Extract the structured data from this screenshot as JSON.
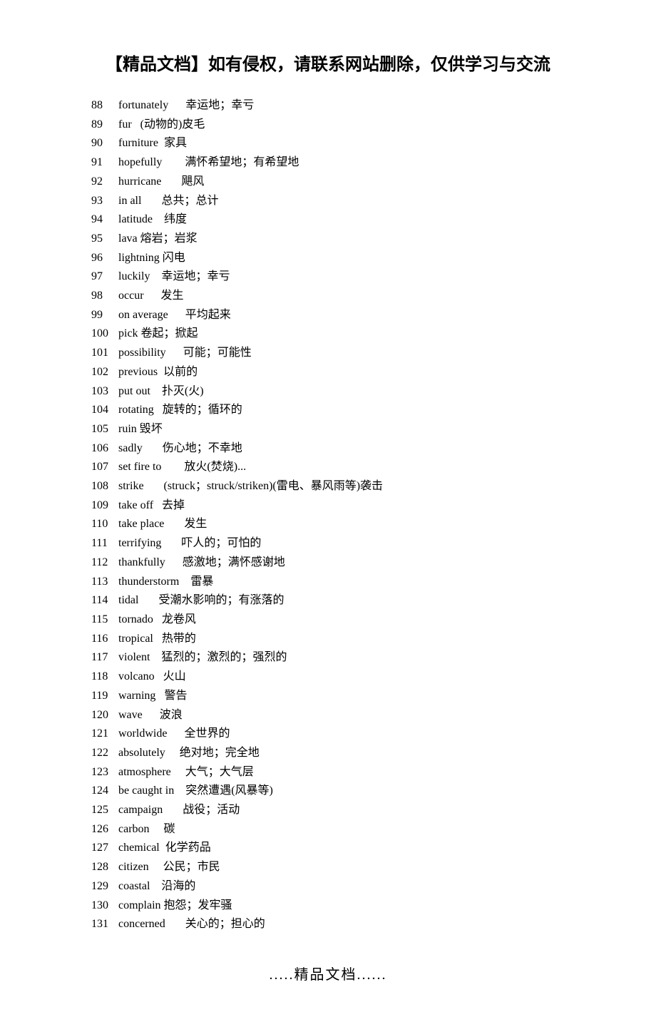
{
  "header": "【精品文档】如有侵权，请联系网站删除，仅供学习与交流",
  "footer": ".....精品文档......",
  "entries": [
    {
      "num": "88",
      "word": "fortunately",
      "gap": "      ",
      "def": "幸运地；幸亏"
    },
    {
      "num": "89",
      "word": "fur",
      "gap": "   ",
      "def": "(动物的)皮毛"
    },
    {
      "num": "90",
      "word": "furniture",
      "gap": "  ",
      "def": "家具"
    },
    {
      "num": "91",
      "word": "hopefully",
      "gap": "        ",
      "def": "满怀希望地；有希望地"
    },
    {
      "num": "92",
      "word": "hurricane",
      "gap": "       ",
      "def": "飓风"
    },
    {
      "num": "93",
      "word": "in all",
      "gap": "       ",
      "def": "总共；总计"
    },
    {
      "num": "94",
      "word": "latitude",
      "gap": "    ",
      "def": "纬度"
    },
    {
      "num": "95",
      "word": "lava",
      "gap": " ",
      "def": "熔岩；岩浆"
    },
    {
      "num": "96",
      "word": "lightning",
      "gap": " ",
      "def": "闪电"
    },
    {
      "num": "97",
      "word": "luckily",
      "gap": "    ",
      "def": "幸运地；幸亏"
    },
    {
      "num": "98",
      "word": "occur",
      "gap": "      ",
      "def": "发生"
    },
    {
      "num": "99",
      "word": "on average",
      "gap": "      ",
      "def": "平均起来"
    },
    {
      "num": "100",
      "word": "pick",
      "gap": " ",
      "def": "卷起；掀起"
    },
    {
      "num": "101",
      "word": "possibility",
      "gap": "      ",
      "def": "可能；可能性"
    },
    {
      "num": "102",
      "word": "previous",
      "gap": "  ",
      "def": "以前的"
    },
    {
      "num": "103",
      "word": "put out",
      "gap": "    ",
      "def": "扑灭(火)"
    },
    {
      "num": "104",
      "word": "rotating",
      "gap": "   ",
      "def": "旋转的；循环的"
    },
    {
      "num": "105",
      "word": "ruin",
      "gap": " ",
      "def": "毁坏"
    },
    {
      "num": "106",
      "word": "sadly",
      "gap": "       ",
      "def": "伤心地；不幸地"
    },
    {
      "num": "107",
      "word": "set fire to",
      "gap": "        ",
      "def": "放火(焚烧)..."
    },
    {
      "num": "108",
      "word": "strike",
      "gap": "       ",
      "def": "(struck；struck/striken)(雷电、暴风雨等)袭击"
    },
    {
      "num": "109",
      "word": "take off",
      "gap": "   ",
      "def": "去掉"
    },
    {
      "num": "110",
      "word": "take place",
      "gap": "       ",
      "def": "发生"
    },
    {
      "num": "111",
      "word": "terrifying",
      "gap": "       ",
      "def": "吓人的；可怕的"
    },
    {
      "num": "112",
      "word": "thankfully",
      "gap": "      ",
      "def": "感激地；满怀感谢地"
    },
    {
      "num": "113",
      "word": "thunderstorm",
      "gap": "    ",
      "def": "雷暴"
    },
    {
      "num": "114",
      "word": "tidal",
      "gap": "       ",
      "def": "受潮水影响的；有涨落的"
    },
    {
      "num": "115",
      "word": "tornado",
      "gap": "   ",
      "def": "龙卷风"
    },
    {
      "num": "116",
      "word": "tropical",
      "gap": "   ",
      "def": "热带的"
    },
    {
      "num": "117",
      "word": "violent",
      "gap": "    ",
      "def": "猛烈的；激烈的；强烈的"
    },
    {
      "num": "118",
      "word": "volcano",
      "gap": "   ",
      "def": "火山"
    },
    {
      "num": "119",
      "word": "warning",
      "gap": "   ",
      "def": "警告"
    },
    {
      "num": "120",
      "word": "wave",
      "gap": "      ",
      "def": "波浪"
    },
    {
      "num": "121",
      "word": "worldwide",
      "gap": "      ",
      "def": "全世界的"
    },
    {
      "num": "122",
      "word": "absolutely",
      "gap": "     ",
      "def": "绝对地；完全地"
    },
    {
      "num": "123",
      "word": "atmosphere",
      "gap": "     ",
      "def": "大气；大气层"
    },
    {
      "num": "124",
      "word": "be caught in",
      "gap": "    ",
      "def": "突然遭遇(风暴等)"
    },
    {
      "num": "125",
      "word": "campaign",
      "gap": "       ",
      "def": "战役；活动"
    },
    {
      "num": "126",
      "word": "carbon",
      "gap": "     ",
      "def": "碳"
    },
    {
      "num": "127",
      "word": "chemical",
      "gap": "  ",
      "def": "化学药品"
    },
    {
      "num": "128",
      "word": "citizen",
      "gap": "     ",
      "def": "公民；市民"
    },
    {
      "num": "129",
      "word": "coastal",
      "gap": "    ",
      "def": "沿海的"
    },
    {
      "num": "130",
      "word": "complain",
      "gap": " ",
      "def": "抱怨；发牢骚"
    },
    {
      "num": "131",
      "word": "concerned",
      "gap": "       ",
      "def": "关心的；担心的"
    }
  ]
}
